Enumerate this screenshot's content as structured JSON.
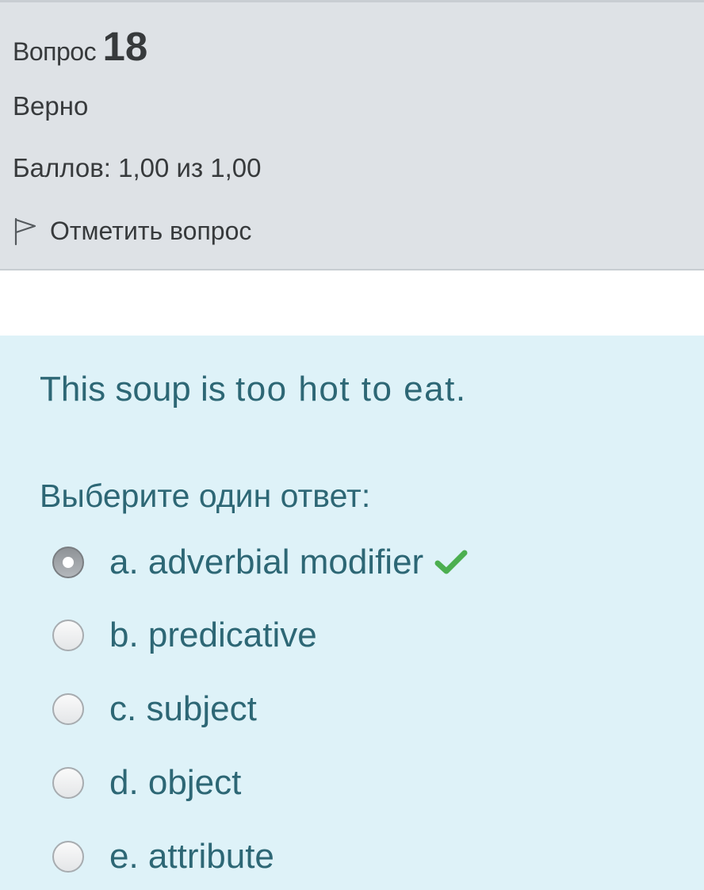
{
  "info": {
    "question_label": "Вопрос",
    "question_number": "18",
    "state": "Верно",
    "grade": "Баллов: 1,00 из 1,00",
    "flag_label": "Отметить вопрос",
    "flag_icon": "flag-outline-icon"
  },
  "question": {
    "text_start": "This soup is ",
    "text_highlight": "too hot to eat",
    "text_end": ".",
    "prompt": "Выберите один ответ:",
    "options": [
      {
        "label": "a. adverbial modifier",
        "selected": true,
        "correct": true
      },
      {
        "label": "b. predicative",
        "selected": false
      },
      {
        "label": "c. subject",
        "selected": false
      },
      {
        "label": "d. object",
        "selected": false
      },
      {
        "label": "e. attribute",
        "selected": false
      }
    ],
    "correct_icon": "checkmark-icon"
  },
  "colors": {
    "info_background": "#dee2e6",
    "content_background": "#def2f8",
    "text_teal": "#2d6775",
    "check_green": "#4caf50"
  }
}
